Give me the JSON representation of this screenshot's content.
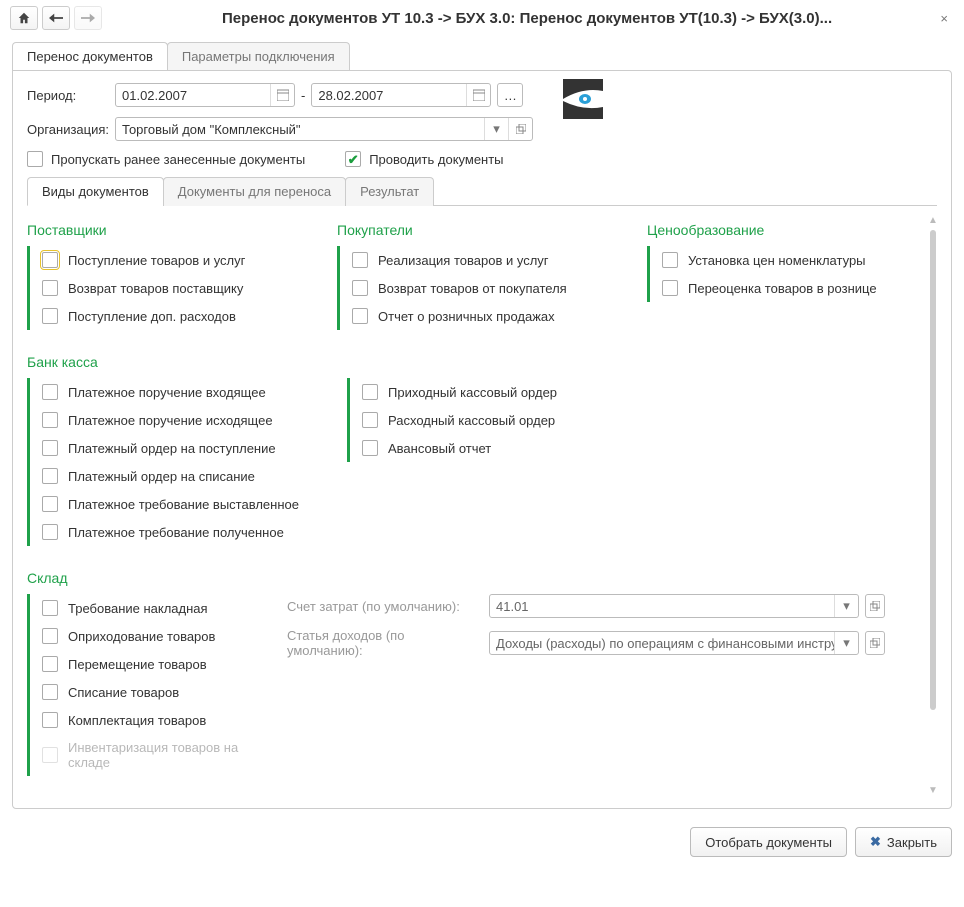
{
  "window": {
    "title": "Перенос документов УТ 10.3 -> БУХ 3.0: Перенос документов УТ(10.3) -> БУХ(3.0)..."
  },
  "main_tabs": {
    "tab0": "Перенос документов",
    "tab1": "Параметры подключения"
  },
  "period": {
    "label": "Период:",
    "from": "01.02.2007",
    "to": "28.02.2007",
    "sep": "-"
  },
  "org": {
    "label": "Организация:",
    "value": "Торговый дом \"Комплексный\""
  },
  "flags": {
    "skip_previous": "Пропускать ранее занесенные документы",
    "skip_checked": false,
    "post_docs": "Проводить документы",
    "post_checked": true
  },
  "inner_tabs": {
    "t0": "Виды документов",
    "t1": "Документы для переноса",
    "t2": "Результат"
  },
  "sections": {
    "suppliers": {
      "title": "Поставщики",
      "i0": "Поступление товаров и услуг",
      "i1": "Возврат товаров поставщику",
      "i2": "Поступление доп. расходов"
    },
    "buyers": {
      "title": "Покупатели",
      "i0": "Реализация товаров и услуг",
      "i1": "Возврат товаров от покупателя",
      "i2": "Отчет о розничных продажах"
    },
    "pricing": {
      "title": "Ценообразование",
      "i0": "Установка цен номенклатуры",
      "i1": "Переоценка товаров в рознице"
    },
    "bank": {
      "title": "Банк касса",
      "left": {
        "i0": "Платежное поручение входящее",
        "i1": "Платежное поручение исходящее",
        "i2": "Платежный ордер на поступление",
        "i3": "Платежный ордер на списание",
        "i4": "Платежное требование выставленное",
        "i5": "Платежное требование полученное"
      },
      "right": {
        "i0": "Приходный кассовый ордер",
        "i1": "Расходный кассовый ордер",
        "i2": "Авансовый отчет"
      }
    },
    "stock": {
      "title": "Склад",
      "left": {
        "i0": "Требование накладная",
        "i1": "Оприходование товаров",
        "i2": "Перемещение товаров",
        "i3": "Списание товаров",
        "i4": "Комплектация товаров",
        "i5": "Инвентаризация товаров на складе"
      },
      "form": {
        "acc_label": "Счет затрат (по умолчанию):",
        "acc_value": "41.01",
        "income_label": "Статья доходов (по умолчанию):",
        "income_value": "Доходы (расходы) по операциям с финансовыми инструме"
      }
    }
  },
  "footer": {
    "select": "Отобрать документы",
    "close": "Закрыть"
  }
}
